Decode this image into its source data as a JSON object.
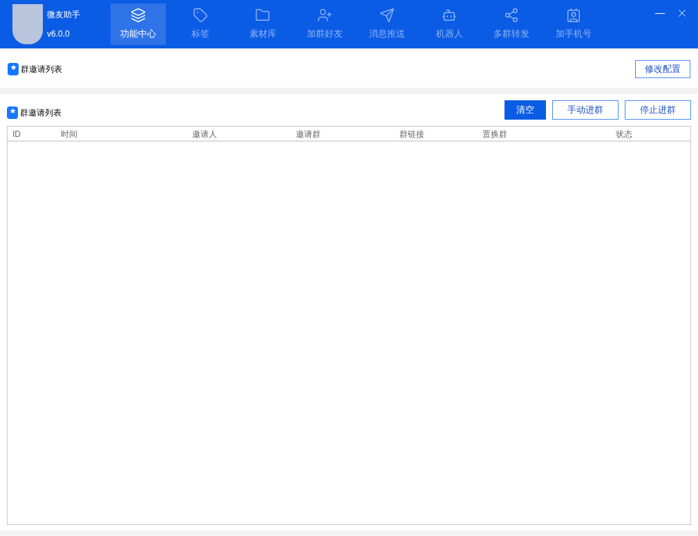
{
  "app": {
    "name": "微友助手",
    "version": "v6.0.0"
  },
  "nav": [
    {
      "label": "功能中心",
      "selected": true
    },
    {
      "label": "标签",
      "selected": false
    },
    {
      "label": "素材库",
      "selected": false
    },
    {
      "label": "加群好友",
      "selected": false
    },
    {
      "label": "消息推送",
      "selected": false
    },
    {
      "label": "机器人",
      "selected": false
    },
    {
      "label": "多群转发",
      "selected": false
    },
    {
      "label": "加手机号",
      "selected": false
    }
  ],
  "config_panel": {
    "title": "群邀请列表",
    "button": "修改配置"
  },
  "list_panel": {
    "title": "群邀请列表",
    "buttons": [
      {
        "label": "清空",
        "kind": "primary"
      },
      {
        "label": "手动进群",
        "kind": "outline"
      },
      {
        "label": "停止进群",
        "kind": "outline"
      }
    ],
    "table": {
      "columns": [
        "ID",
        "时间",
        "邀请人",
        "邀请群",
        "群链接",
        "置换群",
        "状态"
      ]
    }
  }
}
